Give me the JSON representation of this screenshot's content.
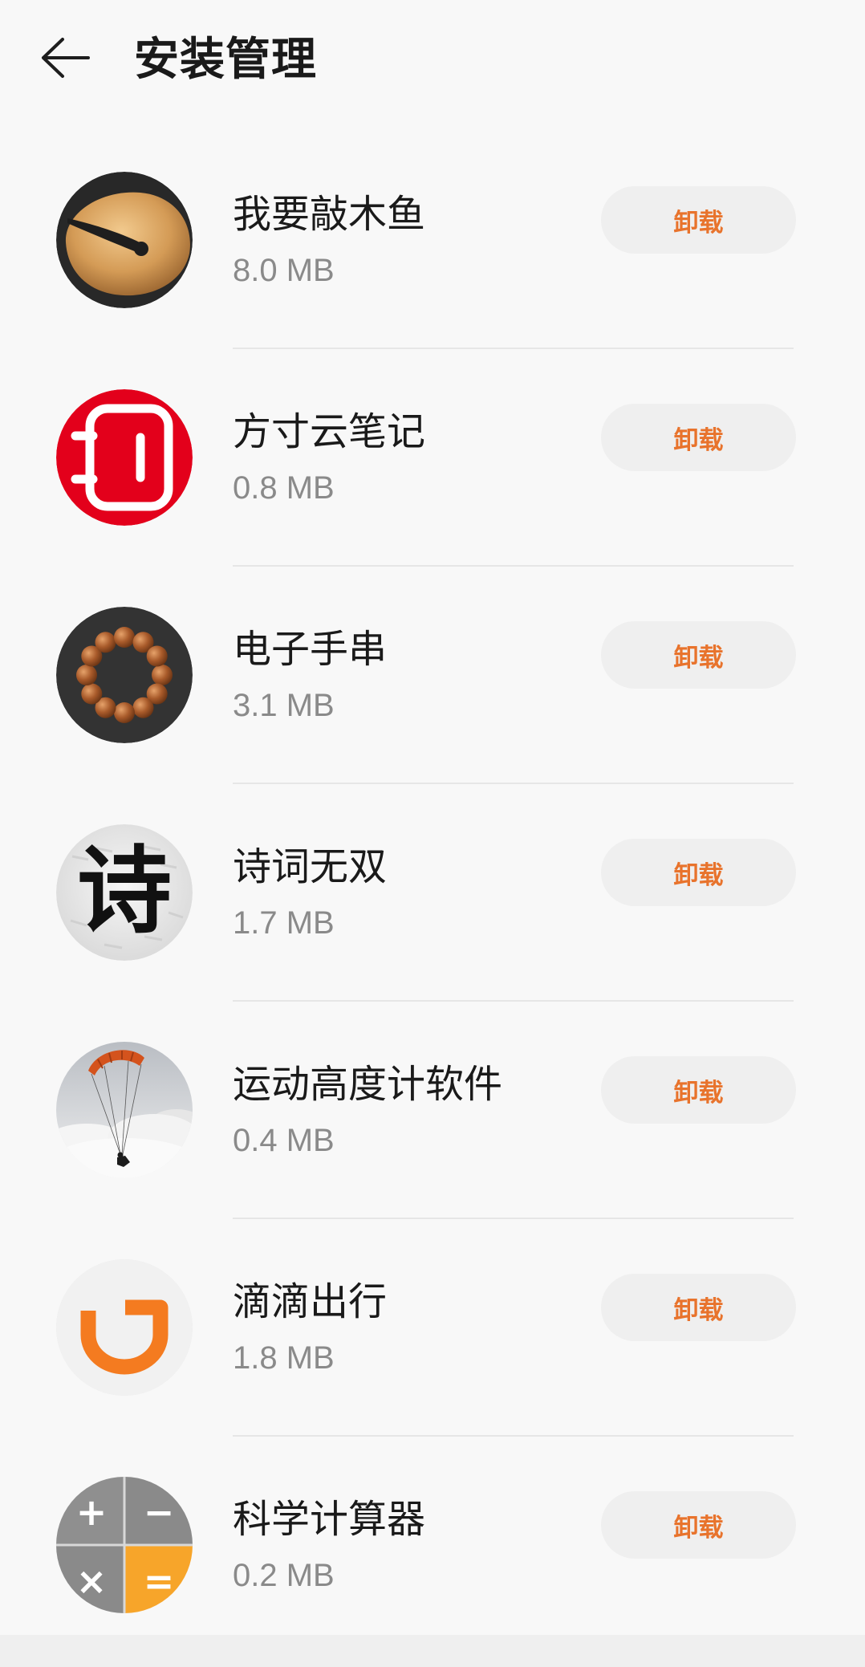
{
  "header": {
    "title": "安装管理",
    "back_icon": "back-arrow-icon"
  },
  "colors": {
    "accent": "#e8732c",
    "background": "#f8f8f8",
    "button_background": "#efefef",
    "secondary_text": "#8a8a8a"
  },
  "apps": [
    {
      "name": "我要敲木鱼",
      "size": "8.0 MB",
      "action": "卸载",
      "icon": "wooden-fish-icon"
    },
    {
      "name": "方寸云笔记",
      "size": "0.8 MB",
      "action": "卸载",
      "icon": "notebook-icon"
    },
    {
      "name": "电子手串",
      "size": "3.1 MB",
      "action": "卸载",
      "icon": "prayer-beads-icon"
    },
    {
      "name": "诗词无双",
      "size": "1.7 MB",
      "action": "卸载",
      "icon": "poetry-icon",
      "icon_text": "诗"
    },
    {
      "name": "运动高度计软件",
      "size": "0.4 MB",
      "action": "卸载",
      "icon": "paraglider-icon"
    },
    {
      "name": "滴滴出行",
      "size": "1.8 MB",
      "action": "卸载",
      "icon": "didi-icon"
    },
    {
      "name": "科学计算器",
      "size": "0.2 MB",
      "action": "卸载",
      "icon": "calculator-icon",
      "icon_symbols": [
        "+",
        "−",
        "×",
        "="
      ]
    }
  ]
}
